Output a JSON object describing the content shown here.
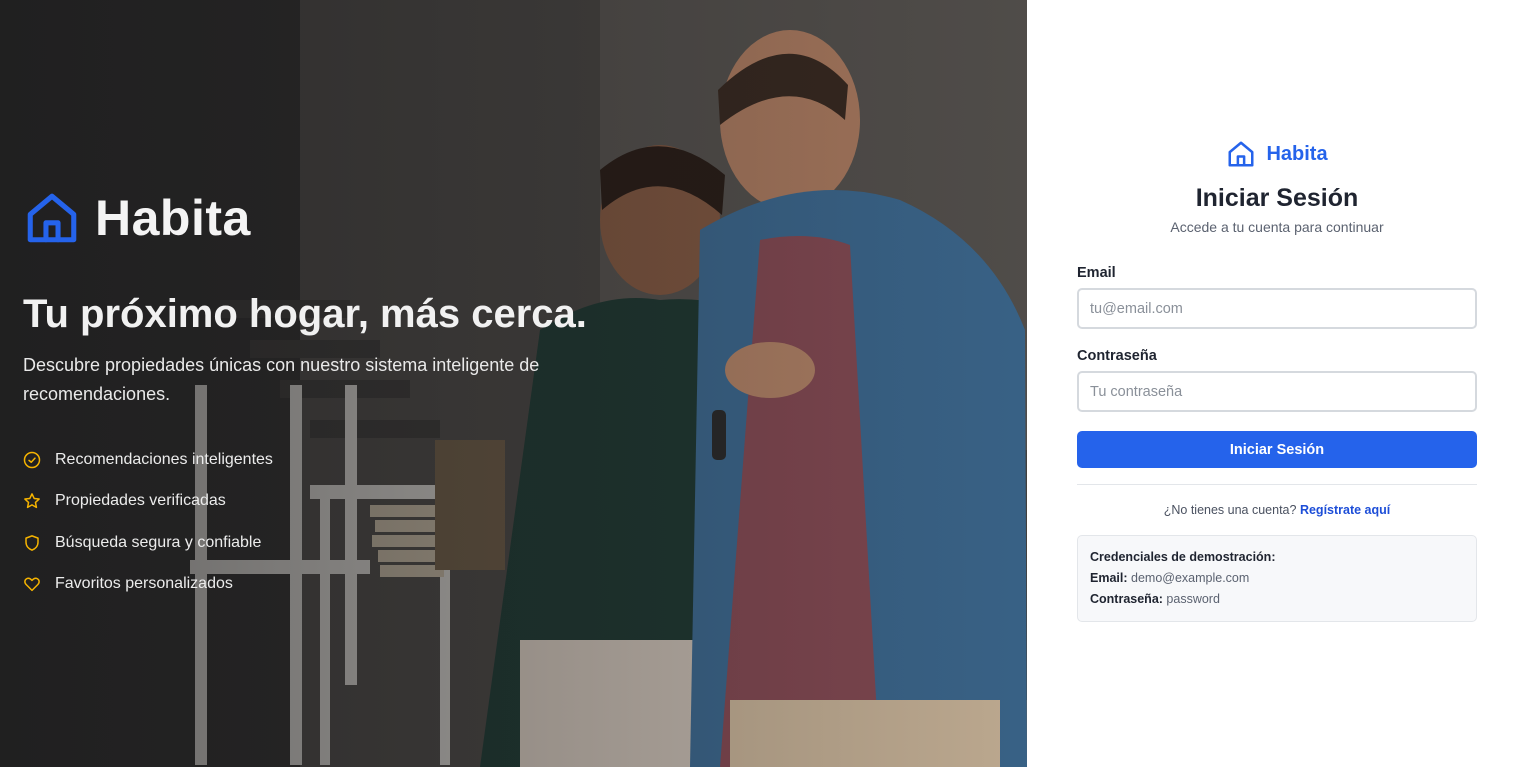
{
  "hero": {
    "brand_name": "Habita",
    "headline": "Tu próximo hogar, más cerca.",
    "description": "Descubre propiedades únicas con nuestro sistema inteligente de recomendaciones.",
    "features": [
      {
        "icon": "check-circle-icon",
        "label": "Recomendaciones inteligentes"
      },
      {
        "icon": "star-icon",
        "label": "Propiedades verificadas"
      },
      {
        "icon": "shield-icon",
        "label": "Búsqueda segura y confiable"
      },
      {
        "icon": "heart-icon",
        "label": "Favoritos personalizados"
      }
    ],
    "accent_color": "#2563eb",
    "feature_icon_color": "#f5b300"
  },
  "login": {
    "brand_name": "Habita",
    "title": "Iniciar Sesión",
    "subtitle": "Accede a tu cuenta para continuar",
    "email_label": "Email",
    "email_placeholder": "tu@email.com",
    "password_label": "Contraseña",
    "password_placeholder": "Tu contraseña",
    "submit_label": "Iniciar Sesión",
    "register_prompt": "¿No tienes una cuenta?",
    "register_link": "Regístrate aquí",
    "demo": {
      "heading": "Credenciales de demostración:",
      "email_label": "Email:",
      "email_value": "demo@example.com",
      "password_label": "Contraseña:",
      "password_value": "password"
    },
    "primary_color": "#2563eb"
  }
}
